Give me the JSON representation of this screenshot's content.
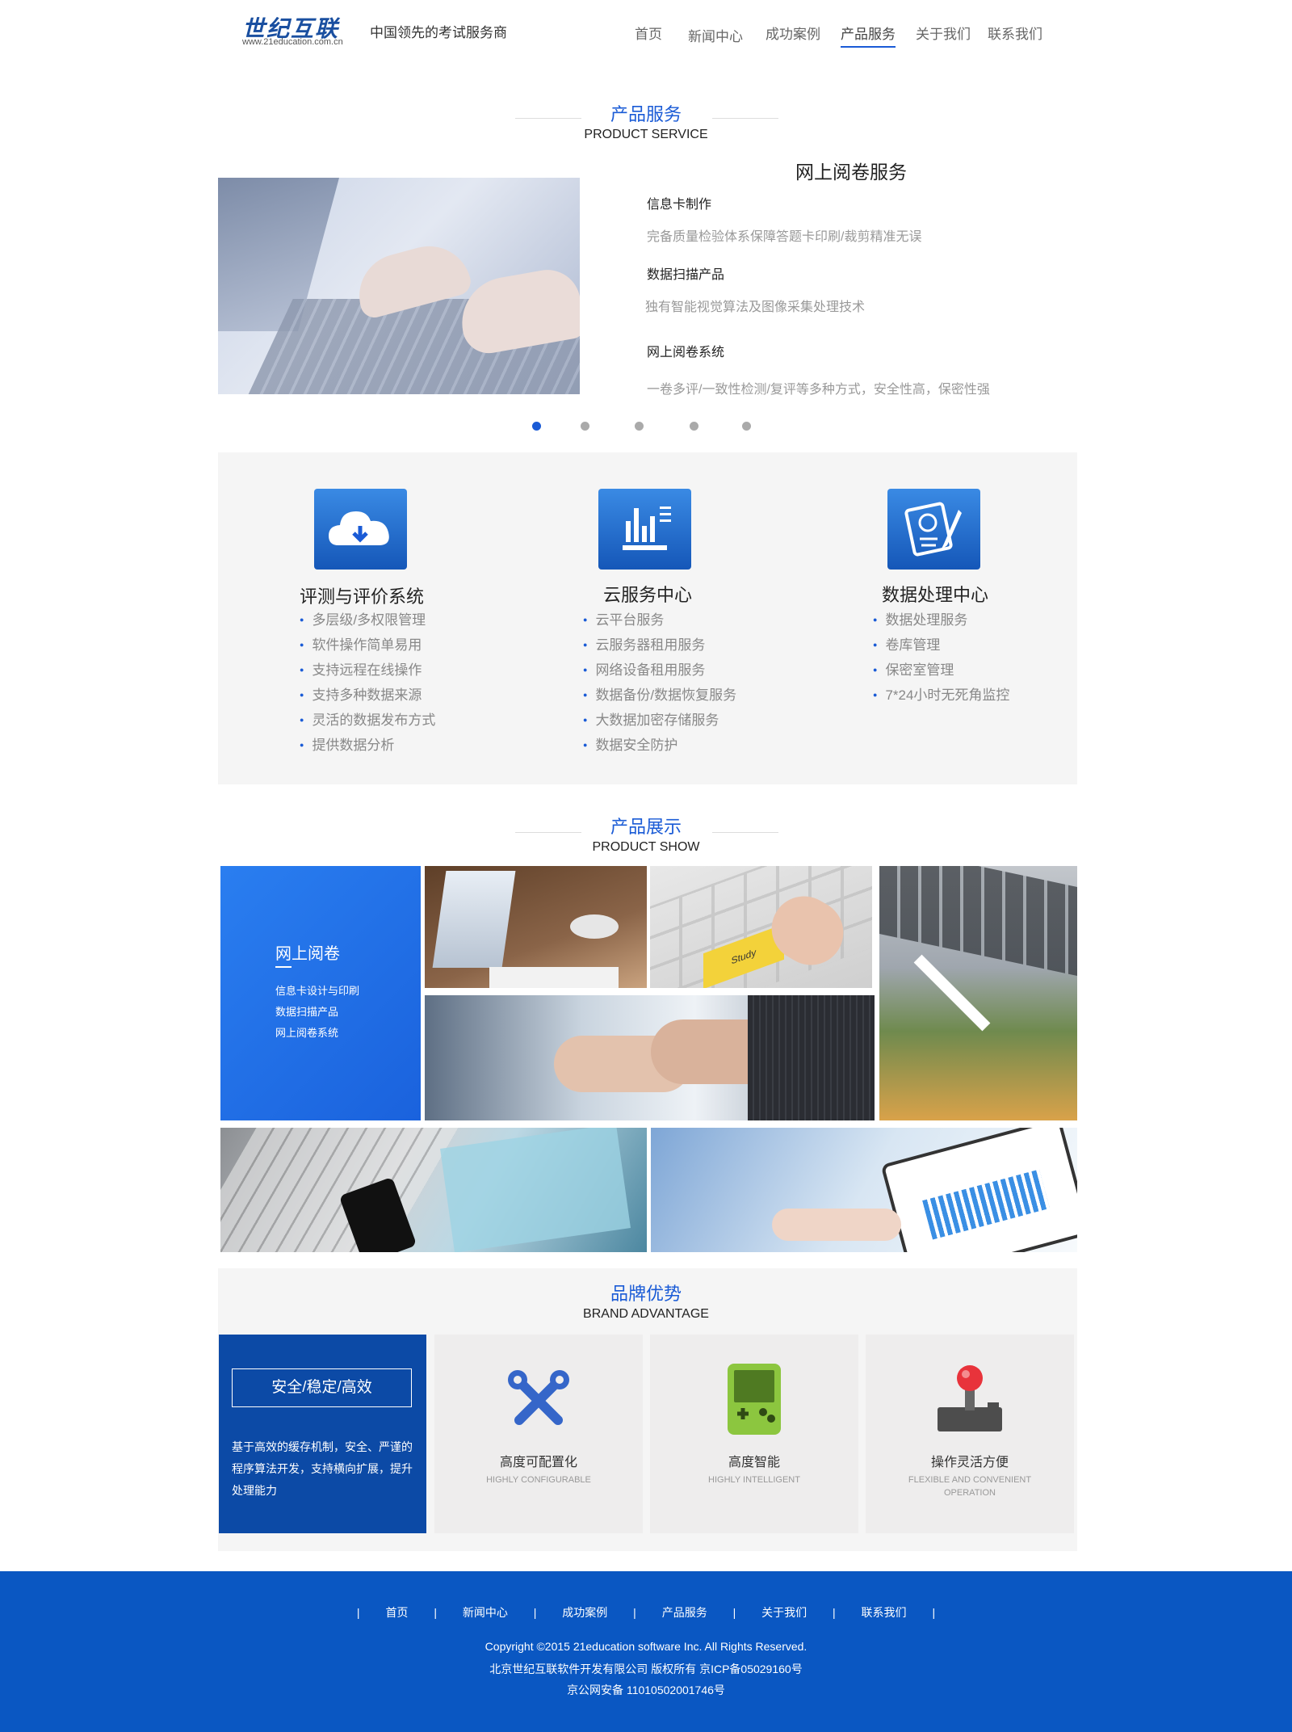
{
  "header": {
    "logo_text": "世纪互联",
    "logo_url": "www.21education.com.cn",
    "slogan": "中国领先的考试服务商",
    "nav": [
      {
        "label": "首页"
      },
      {
        "label": "新闻中心"
      },
      {
        "label": "成功案例"
      },
      {
        "label": "产品服务"
      },
      {
        "label": "关于我们"
      },
      {
        "label": "联系我们"
      }
    ],
    "active_nav": "产品服务"
  },
  "product_service": {
    "title_cn": "产品服务",
    "title_en": "PRODUCT SERVICE",
    "heading": "网上阅卷服务",
    "items": [
      {
        "name": "信息卡制作",
        "desc": "完备质量检验体系保障答题卡印刷/裁剪精准无误"
      },
      {
        "name": "数据扫描产品",
        "desc": "独有智能视觉算法及图像采集处理技术"
      },
      {
        "name": "网上阅卷系统",
        "desc": "一卷多评/一致性检测/复评等多种方式，安全性高，保密性强"
      }
    ],
    "carousel_count": 5,
    "carousel_active": 1
  },
  "features": [
    {
      "icon": "cloud-download-icon",
      "title": "评测与评价系统",
      "items": [
        "多层级/多权限管理",
        "软件操作简单易用",
        "支持远程在线操作",
        "支持多种数据来源",
        "灵活的数据发布方式",
        "提供数据分析"
      ]
    },
    {
      "icon": "bar-chart-icon",
      "title": "云服务中心",
      "items": [
        "云平台服务",
        "云服务器租用服务",
        "网络设备租用服务",
        "数据备份/数据恢复服务",
        "大数据加密存储服务",
        "数据安全防护"
      ]
    },
    {
      "icon": "exam-paper-icon",
      "title": "数据处理中心",
      "items": [
        "数据处理服务",
        "卷库管理",
        "保密室管理",
        "7*24小时无死角监控"
      ]
    }
  ],
  "product_show": {
    "title_cn": "产品展示",
    "title_en": "PRODUCT SHOW",
    "tile_title": "网上阅卷",
    "tile_items": [
      "信息卡设计与印刷",
      "数据扫描产品",
      "网上阅卷系统"
    ],
    "study_key_label": "Study"
  },
  "brand": {
    "title_cn": "品牌优势",
    "title_en": "BRAND ADVANTAGE",
    "highlight": "安全/稳定/高效",
    "description": "基于高效的缓存机制，安全、严谨的程序算法开发，支持横向扩展，提升处理能力",
    "cards": [
      {
        "icon": "wrench-icon",
        "cn": "高度可配置化",
        "en": "HIGHLY CONFIGURABLE"
      },
      {
        "icon": "gameboy-icon",
        "cn": "高度智能",
        "en": "HIGHLY INTELLIGENT"
      },
      {
        "icon": "joystick-icon",
        "cn": "操作灵活方便",
        "en": "FLEXIBLE AND CONVENIENT OPERATION"
      }
    ]
  },
  "footer": {
    "nav": [
      "首页",
      "新闻中心",
      "成功案例",
      "产品服务",
      "关于我们",
      "联系我们"
    ],
    "separator": "|",
    "copyright": "Copyright ©2015 21education software Inc. All Rights Reserved.",
    "company": "北京世纪互联软件开发有限公司 版权所有 京ICP备05029160号",
    "police": "京公网安备 11010502001746号"
  },
  "colors": {
    "accent": "#1a5bd6",
    "footer_bg": "#0a57c2",
    "brand_blue": "#0c4aa6"
  }
}
